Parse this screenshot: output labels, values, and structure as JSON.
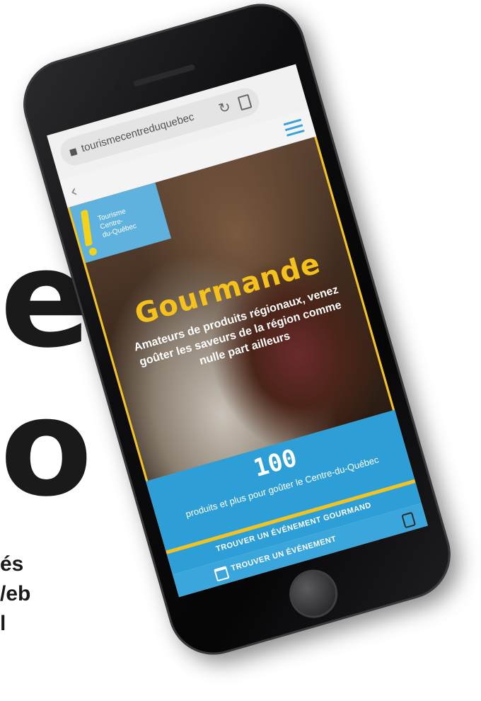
{
  "background": {
    "big_line_1": "ec",
    "big_line_2": "o",
    "small_line_1": "és",
    "small_line_2": "/eb",
    "small_line_3": "l"
  },
  "browser": {
    "url": "tourismecentreduquebec",
    "icons": [
      "lock-icon",
      "reload-icon",
      "bookmark-icon",
      "back-icon",
      "hamburger-icon"
    ]
  },
  "site": {
    "logo_line_1": "Tourisme",
    "logo_line_2": "Centre-",
    "logo_line_3": "du-Québec",
    "hero_title": "Gourmande",
    "hero_subtitle": "Amateurs de produits régionaux, venez goûter les saveurs de la région comme nulle part ailleurs",
    "stat_number": "100",
    "stat_text": "produits et plus pour goûter le Centre-du-Québec",
    "cta_label": "TROUVER UN ÉVÉNEMENT GOURMAND",
    "cta2_label": "TROUVER UN ÉVÉNEMENT"
  },
  "colors": {
    "accent_blue": "#2e9fd6",
    "accent_yellow": "#f4c21a",
    "phone_body": "#0e0e10"
  }
}
